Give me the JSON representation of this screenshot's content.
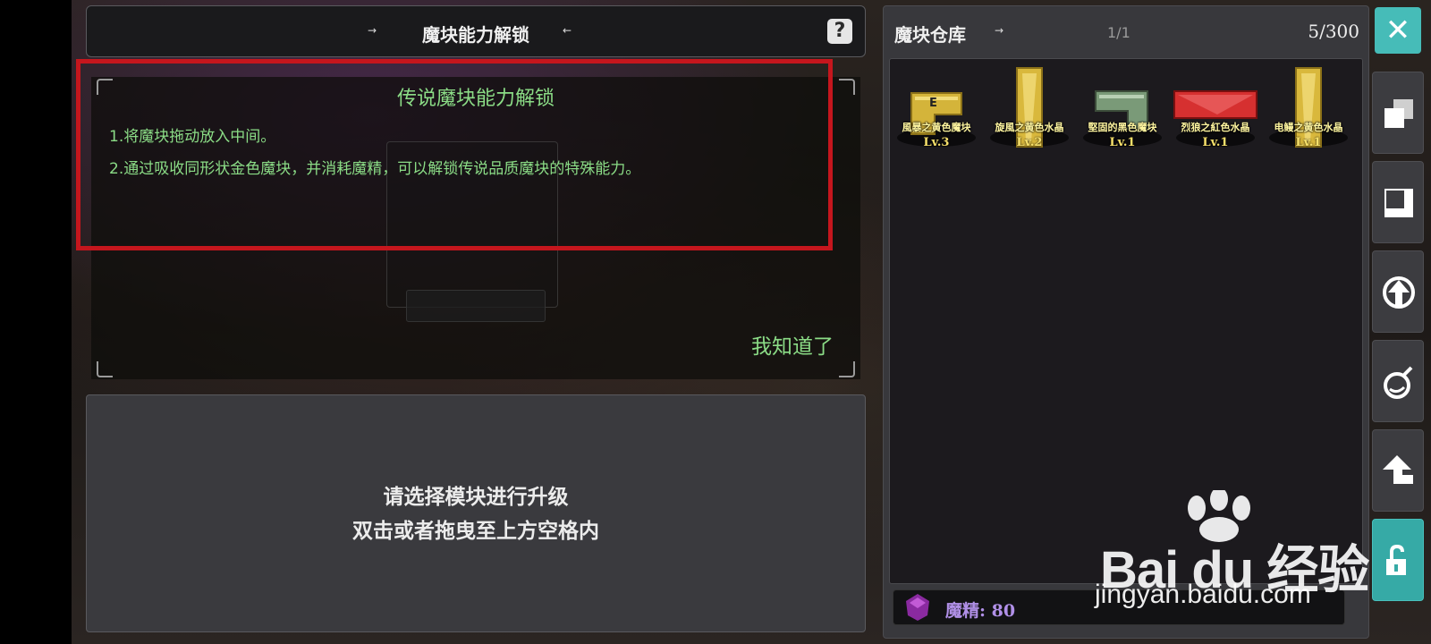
{
  "unlock_header": {
    "title": "魔块能力解锁",
    "help_icon": "?"
  },
  "info_dialog": {
    "title": "传说魔块能力解锁",
    "line1": "1.将魔块拖动放入中间。",
    "line2": "2.通过吸收同形状金色魔块，并消耗魔精，可以解锁传说品质魔块的特殊能力。",
    "confirm_label": "我知道了"
  },
  "select_panel": {
    "line1": "请选择模块进行升级",
    "line2": "双击或者拖曳至上方空格内"
  },
  "warehouse": {
    "title": "魔块仓库",
    "page": "1/1",
    "count": "5/300",
    "items": [
      {
        "name": "風暴之黄色魔块",
        "level": "Lv.3",
        "color": "#d4b43a",
        "badge": "E"
      },
      {
        "name": "旋風之黄色水晶",
        "level": "Lv.2",
        "color": "#d9b83c"
      },
      {
        "name": "堅固的黑色魔块",
        "level": "Lv.1",
        "color": "#7a9a78"
      },
      {
        "name": "烈狼之紅色水晶",
        "level": "Lv.1",
        "color": "#d63030"
      },
      {
        "name": "电鳗之黄色水晶",
        "level": "Lv.1",
        "color": "#d9b83c"
      }
    ],
    "essence": {
      "label": "魔精: 80"
    }
  },
  "sidebar": {
    "close_icon": "✕",
    "buttons": [
      {
        "icon": "stack-icon"
      },
      {
        "icon": "frame-icon"
      },
      {
        "icon": "upgrade-icon"
      },
      {
        "icon": "bomb-icon"
      },
      {
        "icon": "return-icon"
      },
      {
        "icon": "unlock-icon",
        "active": true
      }
    ]
  },
  "watermark": {
    "logo": "Bai du 经验",
    "url": "jingyan.baidu.com"
  },
  "colors": {
    "accent_teal": "#46bcb8",
    "dialog_green": "#8bdc86",
    "highlight_red": "#c5161d",
    "essence_purple": "#b190e8"
  }
}
